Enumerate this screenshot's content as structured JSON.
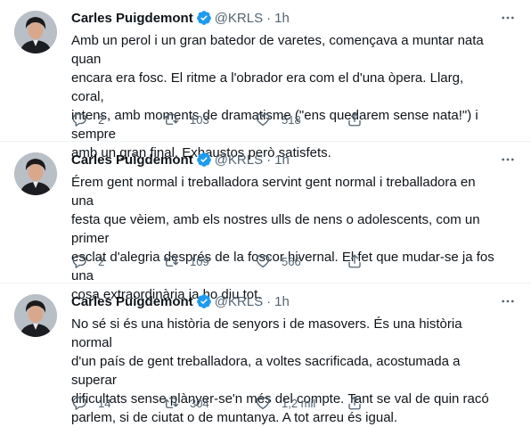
{
  "tweets": [
    {
      "author_name": "Carles Puigdemont",
      "handle": "@KRLS",
      "separator": "·",
      "time": "1h",
      "text": "Amb un perol i un gran batedor de varetes, començava a muntar nata quan\nencara era fosc. El ritme a l'obrador era com el d'una òpera. Llarg, coral,\nintens, amb moments de dramatisme (\"ens quedarem sense nata!\") i sempre\namb un gran final. Exhaustos però satisfets.",
      "replies": "2",
      "retweets": "103",
      "likes": "518"
    },
    {
      "author_name": "Carles Puigdemont",
      "handle": "@KRLS",
      "separator": "·",
      "time": "1h",
      "text": "Érem gent normal i treballadora servint gent normal i treballadora en una\nfesta que vèiem, amb els nostres ulls de nens o adolescents, com un primer\nesclat d'alegria després de la foscor hivernal. El fet que mudar-se ja fos una\ncosa extraordinària ja ho diu tot.",
      "replies": "2",
      "retweets": "109",
      "likes": "566"
    },
    {
      "author_name": "Carles Puigdemont",
      "handle": "@KRLS",
      "separator": "·",
      "time": "1h",
      "text": "No sé si és una història de senyors i de masovers. És una història normal\nd'un país de gent treballadora, a voltes sacrificada, acostumada a superar\ndificultats sense plànyer-se'n més del compte. Tant se val de quin racó\nparlem, si de ciutat o de muntanya. A tot arreu és igual.",
      "replies": "14",
      "retweets": "304",
      "likes": "1,2 mil"
    }
  ],
  "icons": {
    "verified": "verified-badge-icon",
    "more": "more-dots-icon",
    "reply": "reply-icon",
    "retweet": "retweet-icon",
    "like": "heart-icon",
    "share": "share-icon"
  },
  "colors": {
    "text": "#0f1419",
    "secondary": "#536471",
    "verified": "#1d9bf0",
    "divider": "#eff3f4"
  }
}
